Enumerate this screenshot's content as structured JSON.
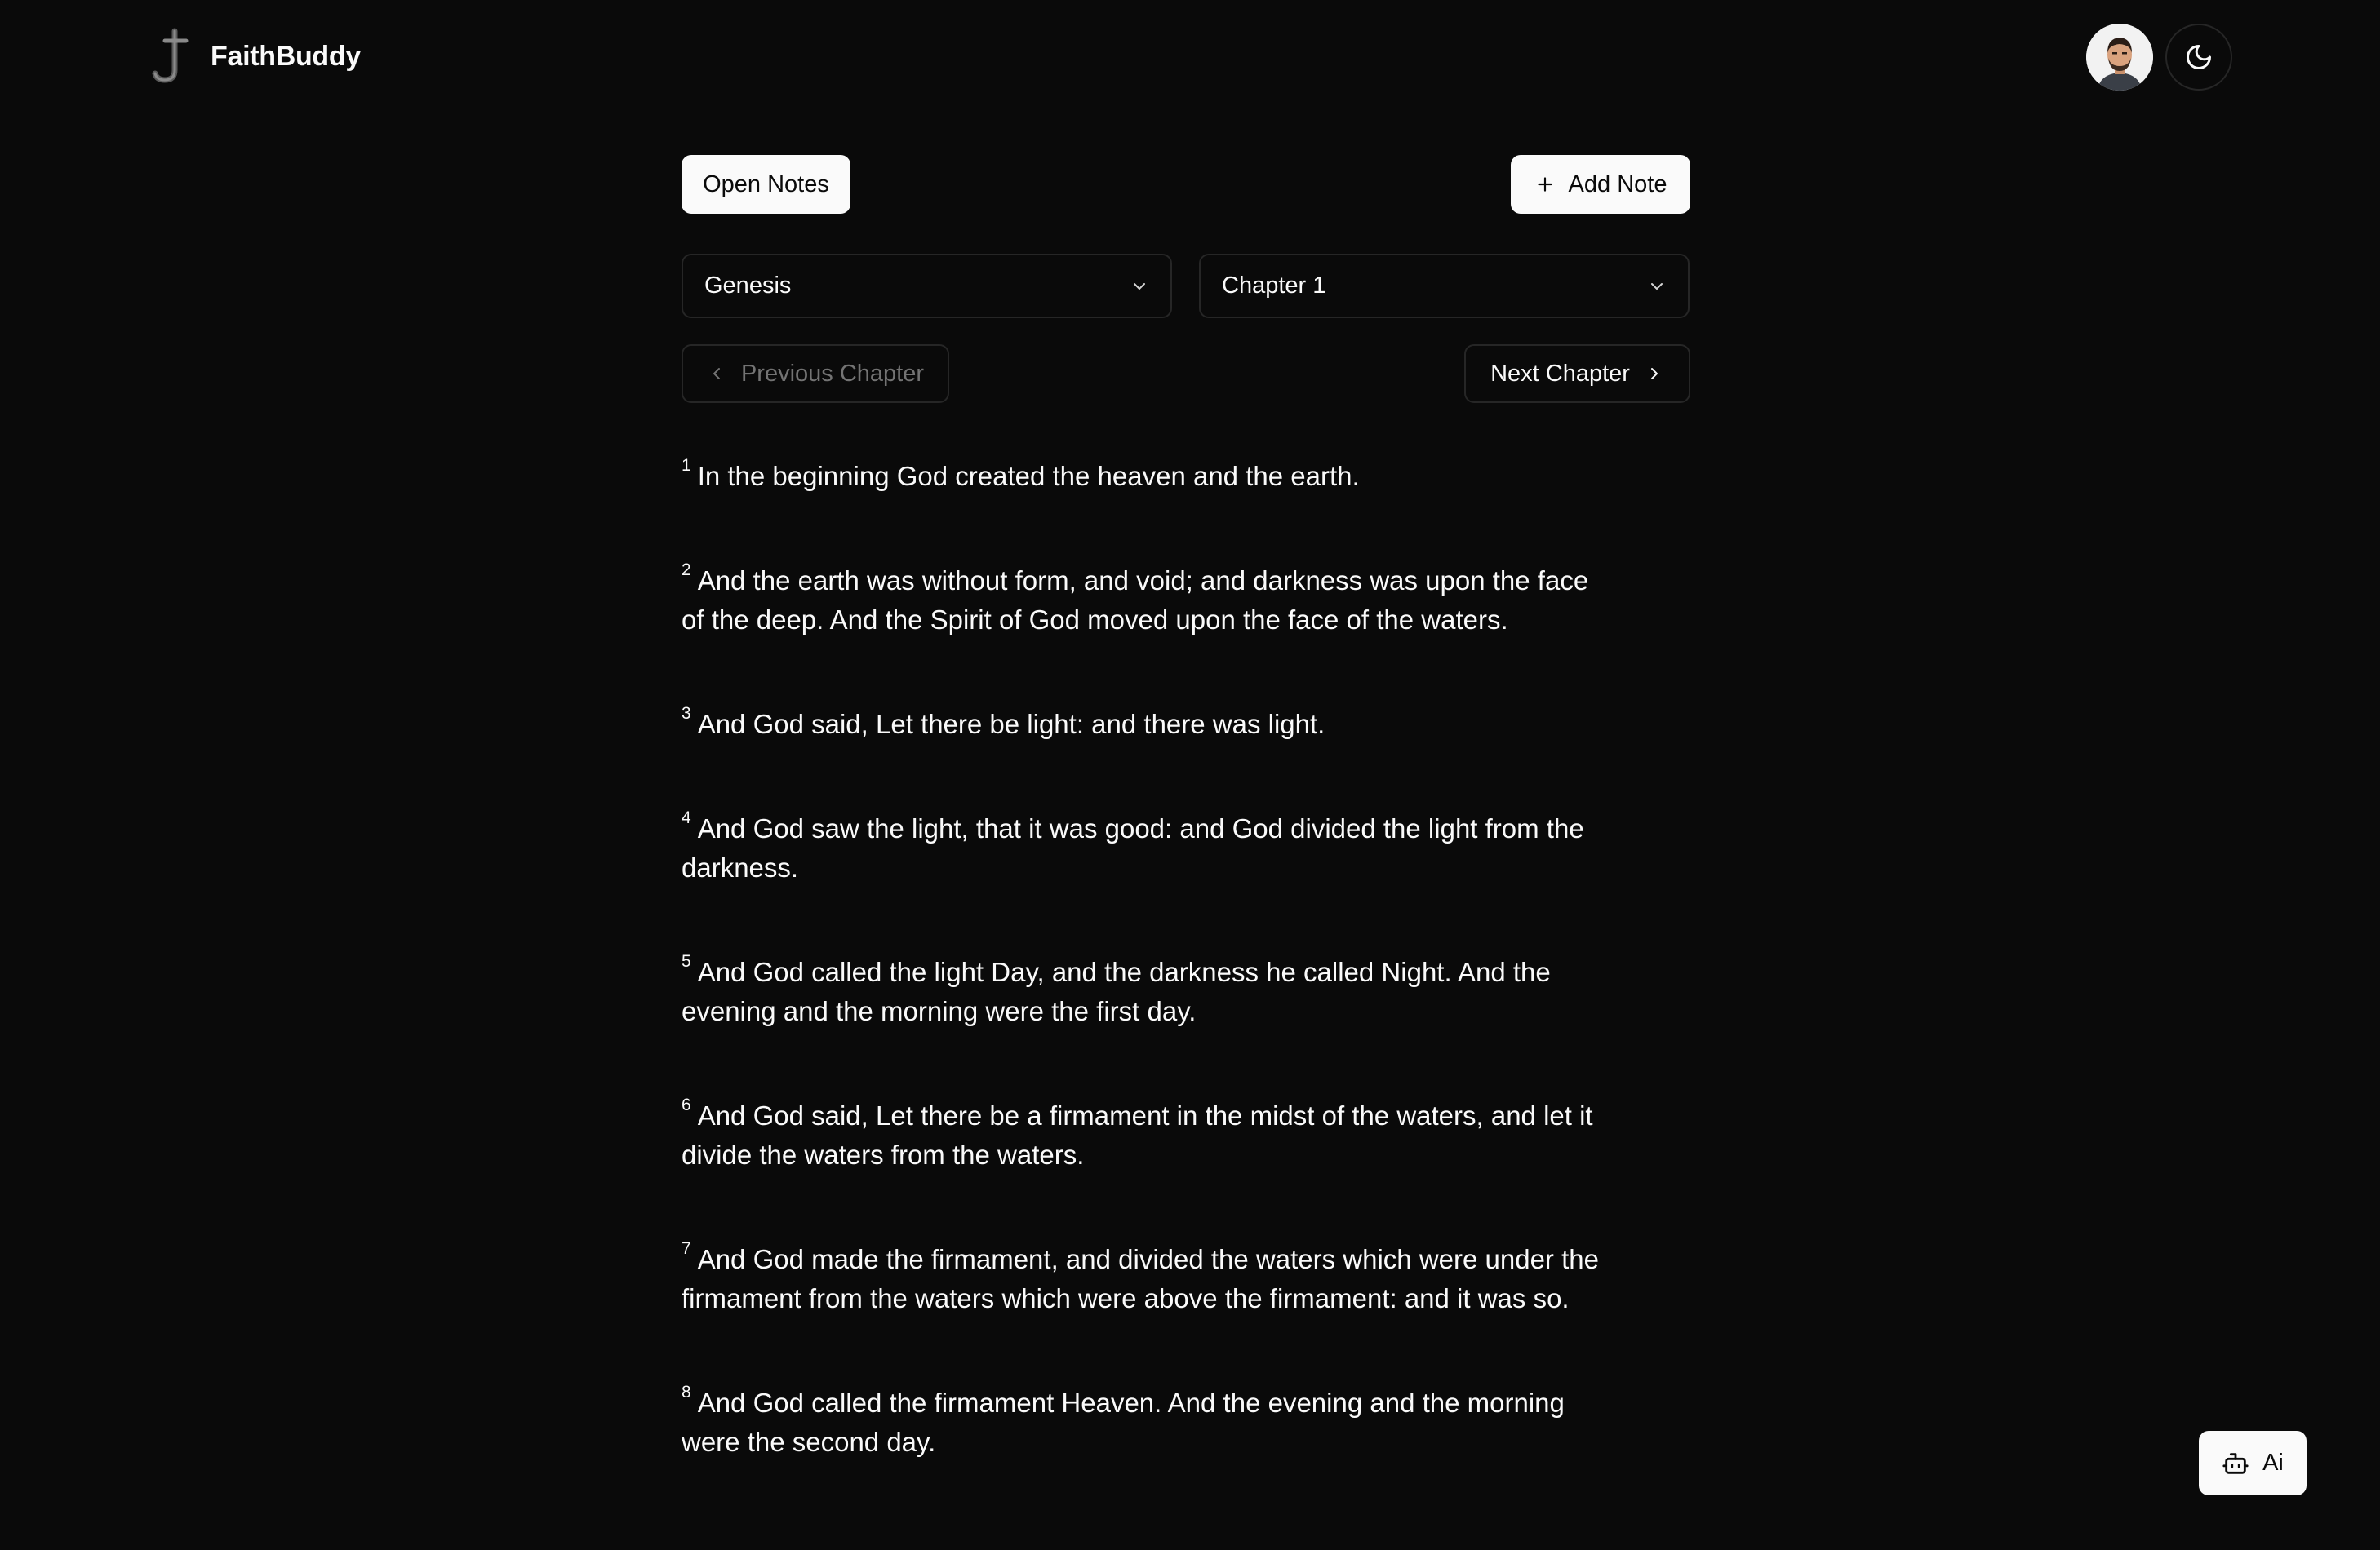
{
  "app": {
    "name": "FaithBuddy"
  },
  "header": {
    "avatar_alt": "User avatar",
    "theme_toggle": "moon-icon"
  },
  "toolbar": {
    "open_notes_label": "Open Notes",
    "add_note_label": "Add Note"
  },
  "selectors": {
    "book": "Genesis",
    "chapter": "Chapter 1"
  },
  "navigation": {
    "previous_label": "Previous Chapter",
    "next_label": "Next Chapter"
  },
  "verses": [
    {
      "num": "1",
      "text": "In the beginning God created the heaven and the earth."
    },
    {
      "num": "2",
      "text": "And the earth was without form, and void; and darkness was upon the face of the deep. And the Spirit of God moved upon the face of the waters."
    },
    {
      "num": "3",
      "text": "And God said, Let there be light: and there was light."
    },
    {
      "num": "4",
      "text": "And God saw the light, that it was good: and God divided the light from the darkness."
    },
    {
      "num": "5",
      "text": "And God called the light Day, and the darkness he called Night. And the evening and the morning were the first day."
    },
    {
      "num": "6",
      "text": "And God said, Let there be a firmament in the midst of the waters, and let it divide the waters from the waters."
    },
    {
      "num": "7",
      "text": "And God made the firmament, and divided the waters which were under the firmament from the waters which were above the firmament: and it was so."
    },
    {
      "num": "8",
      "text": "And God called the firmament Heaven. And the evening and the morning were the second day."
    }
  ],
  "ai_button": {
    "label": "Ai"
  },
  "colors": {
    "background": "#0a0a0a",
    "foreground": "#fafafa",
    "border": "#262626",
    "muted": "#737373"
  }
}
